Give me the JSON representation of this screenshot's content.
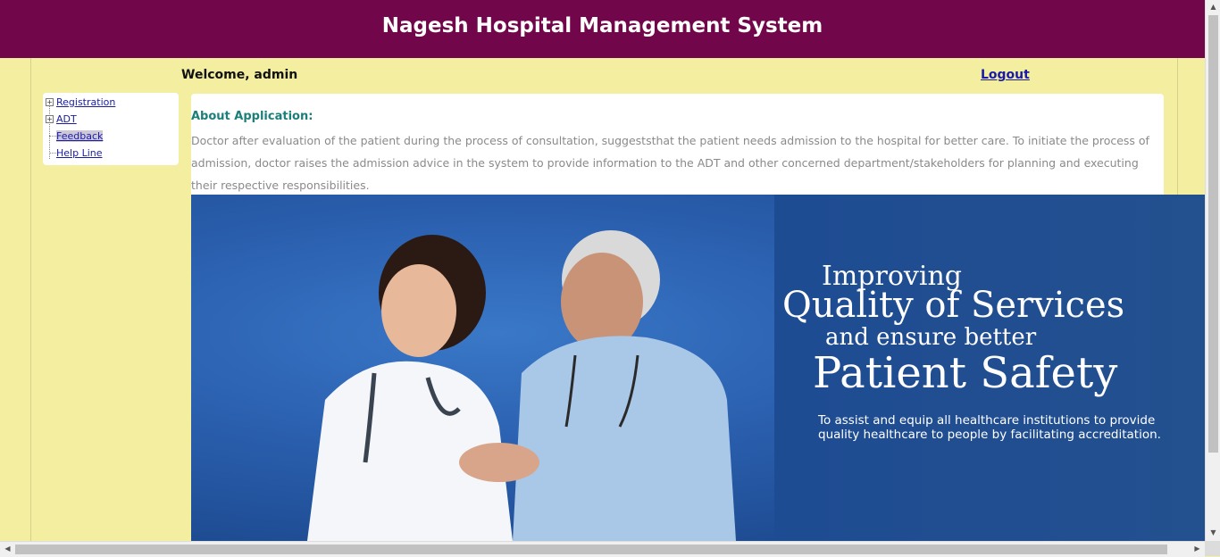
{
  "header": {
    "title": "Nagesh Hospital Management System"
  },
  "welcome_text": "Welcome, admin",
  "logout_label": "Logout",
  "menu": {
    "items": [
      {
        "label": "Registration"
      },
      {
        "label": "ADT"
      },
      {
        "label": "Feedback"
      },
      {
        "label": "Help Line"
      }
    ]
  },
  "about": {
    "title": "About Application:",
    "text": "Doctor after evaluation of the patient during the process of consultation, suggeststhat the patient needs admission to the hospital for better care. To initiate the process of admission, doctor raises the admission advice in the system to provide information to the ADT and other concerned department/stakeholders for planning and executing their respective responsibilities."
  },
  "banner": {
    "line1": "Improving",
    "line2": "Quality of Services",
    "line3": "and ensure better",
    "line4": "Patient Safety",
    "subtext": "To assist and equip all healthcare institutions to provide quality healthcare to people by facilitating accreditation."
  }
}
